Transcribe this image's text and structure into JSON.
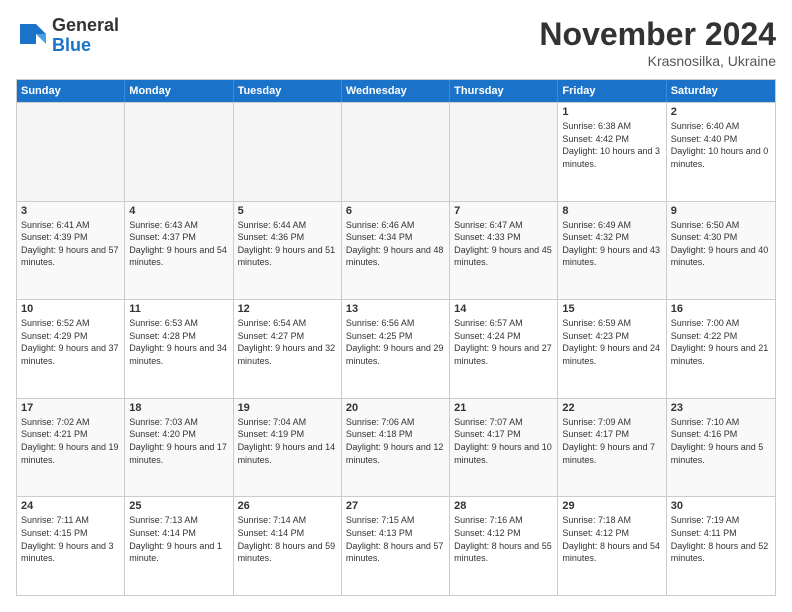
{
  "logo": {
    "general": "General",
    "blue": "Blue"
  },
  "header": {
    "month": "November 2024",
    "location": "Krasnosilka, Ukraine"
  },
  "weekdays": [
    "Sunday",
    "Monday",
    "Tuesday",
    "Wednesday",
    "Thursday",
    "Friday",
    "Saturday"
  ],
  "rows": [
    [
      {
        "day": "",
        "empty": true
      },
      {
        "day": "",
        "empty": true
      },
      {
        "day": "",
        "empty": true
      },
      {
        "day": "",
        "empty": true
      },
      {
        "day": "",
        "empty": true
      },
      {
        "day": "1",
        "sunrise": "Sunrise: 6:38 AM",
        "sunset": "Sunset: 4:42 PM",
        "daylight": "Daylight: 10 hours and 3 minutes."
      },
      {
        "day": "2",
        "sunrise": "Sunrise: 6:40 AM",
        "sunset": "Sunset: 4:40 PM",
        "daylight": "Daylight: 10 hours and 0 minutes."
      }
    ],
    [
      {
        "day": "3",
        "sunrise": "Sunrise: 6:41 AM",
        "sunset": "Sunset: 4:39 PM",
        "daylight": "Daylight: 9 hours and 57 minutes."
      },
      {
        "day": "4",
        "sunrise": "Sunrise: 6:43 AM",
        "sunset": "Sunset: 4:37 PM",
        "daylight": "Daylight: 9 hours and 54 minutes."
      },
      {
        "day": "5",
        "sunrise": "Sunrise: 6:44 AM",
        "sunset": "Sunset: 4:36 PM",
        "daylight": "Daylight: 9 hours and 51 minutes."
      },
      {
        "day": "6",
        "sunrise": "Sunrise: 6:46 AM",
        "sunset": "Sunset: 4:34 PM",
        "daylight": "Daylight: 9 hours and 48 minutes."
      },
      {
        "day": "7",
        "sunrise": "Sunrise: 6:47 AM",
        "sunset": "Sunset: 4:33 PM",
        "daylight": "Daylight: 9 hours and 45 minutes."
      },
      {
        "day": "8",
        "sunrise": "Sunrise: 6:49 AM",
        "sunset": "Sunset: 4:32 PM",
        "daylight": "Daylight: 9 hours and 43 minutes."
      },
      {
        "day": "9",
        "sunrise": "Sunrise: 6:50 AM",
        "sunset": "Sunset: 4:30 PM",
        "daylight": "Daylight: 9 hours and 40 minutes."
      }
    ],
    [
      {
        "day": "10",
        "sunrise": "Sunrise: 6:52 AM",
        "sunset": "Sunset: 4:29 PM",
        "daylight": "Daylight: 9 hours and 37 minutes."
      },
      {
        "day": "11",
        "sunrise": "Sunrise: 6:53 AM",
        "sunset": "Sunset: 4:28 PM",
        "daylight": "Daylight: 9 hours and 34 minutes."
      },
      {
        "day": "12",
        "sunrise": "Sunrise: 6:54 AM",
        "sunset": "Sunset: 4:27 PM",
        "daylight": "Daylight: 9 hours and 32 minutes."
      },
      {
        "day": "13",
        "sunrise": "Sunrise: 6:56 AM",
        "sunset": "Sunset: 4:25 PM",
        "daylight": "Daylight: 9 hours and 29 minutes."
      },
      {
        "day": "14",
        "sunrise": "Sunrise: 6:57 AM",
        "sunset": "Sunset: 4:24 PM",
        "daylight": "Daylight: 9 hours and 27 minutes."
      },
      {
        "day": "15",
        "sunrise": "Sunrise: 6:59 AM",
        "sunset": "Sunset: 4:23 PM",
        "daylight": "Daylight: 9 hours and 24 minutes."
      },
      {
        "day": "16",
        "sunrise": "Sunrise: 7:00 AM",
        "sunset": "Sunset: 4:22 PM",
        "daylight": "Daylight: 9 hours and 21 minutes."
      }
    ],
    [
      {
        "day": "17",
        "sunrise": "Sunrise: 7:02 AM",
        "sunset": "Sunset: 4:21 PM",
        "daylight": "Daylight: 9 hours and 19 minutes."
      },
      {
        "day": "18",
        "sunrise": "Sunrise: 7:03 AM",
        "sunset": "Sunset: 4:20 PM",
        "daylight": "Daylight: 9 hours and 17 minutes."
      },
      {
        "day": "19",
        "sunrise": "Sunrise: 7:04 AM",
        "sunset": "Sunset: 4:19 PM",
        "daylight": "Daylight: 9 hours and 14 minutes."
      },
      {
        "day": "20",
        "sunrise": "Sunrise: 7:06 AM",
        "sunset": "Sunset: 4:18 PM",
        "daylight": "Daylight: 9 hours and 12 minutes."
      },
      {
        "day": "21",
        "sunrise": "Sunrise: 7:07 AM",
        "sunset": "Sunset: 4:17 PM",
        "daylight": "Daylight: 9 hours and 10 minutes."
      },
      {
        "day": "22",
        "sunrise": "Sunrise: 7:09 AM",
        "sunset": "Sunset: 4:17 PM",
        "daylight": "Daylight: 9 hours and 7 minutes."
      },
      {
        "day": "23",
        "sunrise": "Sunrise: 7:10 AM",
        "sunset": "Sunset: 4:16 PM",
        "daylight": "Daylight: 9 hours and 5 minutes."
      }
    ],
    [
      {
        "day": "24",
        "sunrise": "Sunrise: 7:11 AM",
        "sunset": "Sunset: 4:15 PM",
        "daylight": "Daylight: 9 hours and 3 minutes."
      },
      {
        "day": "25",
        "sunrise": "Sunrise: 7:13 AM",
        "sunset": "Sunset: 4:14 PM",
        "daylight": "Daylight: 9 hours and 1 minute."
      },
      {
        "day": "26",
        "sunrise": "Sunrise: 7:14 AM",
        "sunset": "Sunset: 4:14 PM",
        "daylight": "Daylight: 8 hours and 59 minutes."
      },
      {
        "day": "27",
        "sunrise": "Sunrise: 7:15 AM",
        "sunset": "Sunset: 4:13 PM",
        "daylight": "Daylight: 8 hours and 57 minutes."
      },
      {
        "day": "28",
        "sunrise": "Sunrise: 7:16 AM",
        "sunset": "Sunset: 4:12 PM",
        "daylight": "Daylight: 8 hours and 55 minutes."
      },
      {
        "day": "29",
        "sunrise": "Sunrise: 7:18 AM",
        "sunset": "Sunset: 4:12 PM",
        "daylight": "Daylight: 8 hours and 54 minutes."
      },
      {
        "day": "30",
        "sunrise": "Sunrise: 7:19 AM",
        "sunset": "Sunset: 4:11 PM",
        "daylight": "Daylight: 8 hours and 52 minutes."
      }
    ]
  ]
}
